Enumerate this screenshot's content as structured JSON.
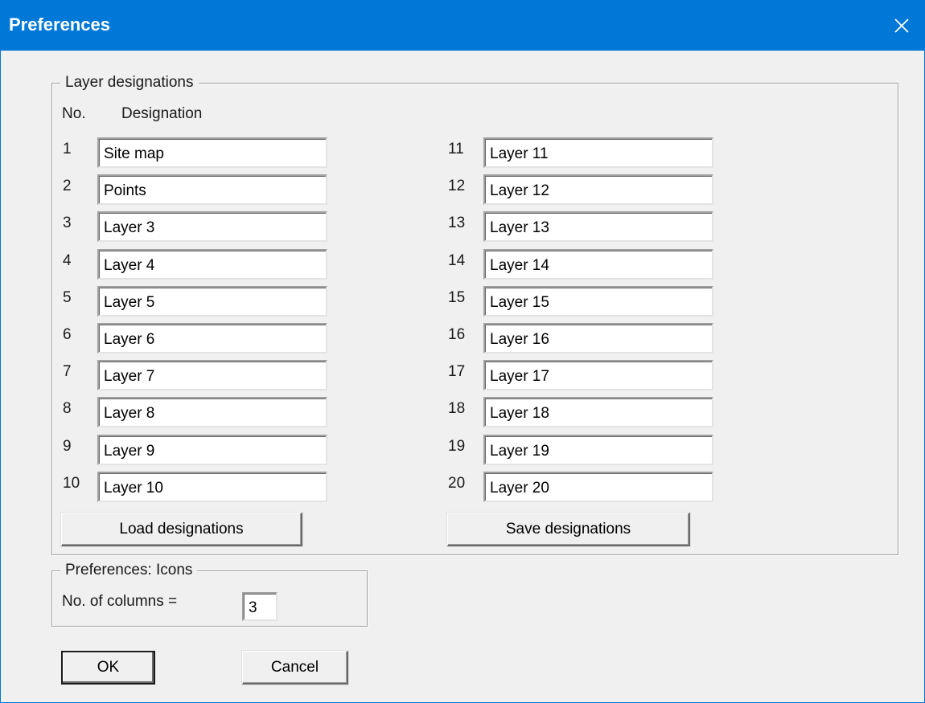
{
  "window": {
    "title": "Preferences"
  },
  "layer_group": {
    "label": "Layer designations",
    "col_no": "No.",
    "col_designation": "Designation",
    "left_rows": [
      {
        "no": "1",
        "value": "Site map"
      },
      {
        "no": "2",
        "value": "Points"
      },
      {
        "no": "3",
        "value": "Layer 3"
      },
      {
        "no": "4",
        "value": "Layer 4"
      },
      {
        "no": "5",
        "value": "Layer 5"
      },
      {
        "no": "6",
        "value": "Layer 6"
      },
      {
        "no": "7",
        "value": "Layer 7"
      },
      {
        "no": "8",
        "value": "Layer 8"
      },
      {
        "no": "9",
        "value": "Layer 9"
      },
      {
        "no": "10",
        "value": "Layer 10"
      }
    ],
    "right_rows": [
      {
        "no": "11",
        "value": "Layer 11"
      },
      {
        "no": "12",
        "value": "Layer 12"
      },
      {
        "no": "13",
        "value": "Layer 13"
      },
      {
        "no": "14",
        "value": "Layer 14"
      },
      {
        "no": "15",
        "value": "Layer 15"
      },
      {
        "no": "16",
        "value": "Layer 16"
      },
      {
        "no": "17",
        "value": "Layer 17"
      },
      {
        "no": "18",
        "value": "Layer 18"
      },
      {
        "no": "19",
        "value": "Layer 19"
      },
      {
        "no": "20",
        "value": "Layer 20"
      }
    ],
    "load_button": "Load designations",
    "save_button": "Save designations"
  },
  "icons_group": {
    "label": "Preferences: Icons",
    "columns_label": "No. of columns =",
    "columns_value": "3"
  },
  "buttons": {
    "ok": "OK",
    "cancel": "Cancel"
  },
  "colors": {
    "titlebar": "#0078d7",
    "dialog_bg": "#f0f0f0"
  }
}
